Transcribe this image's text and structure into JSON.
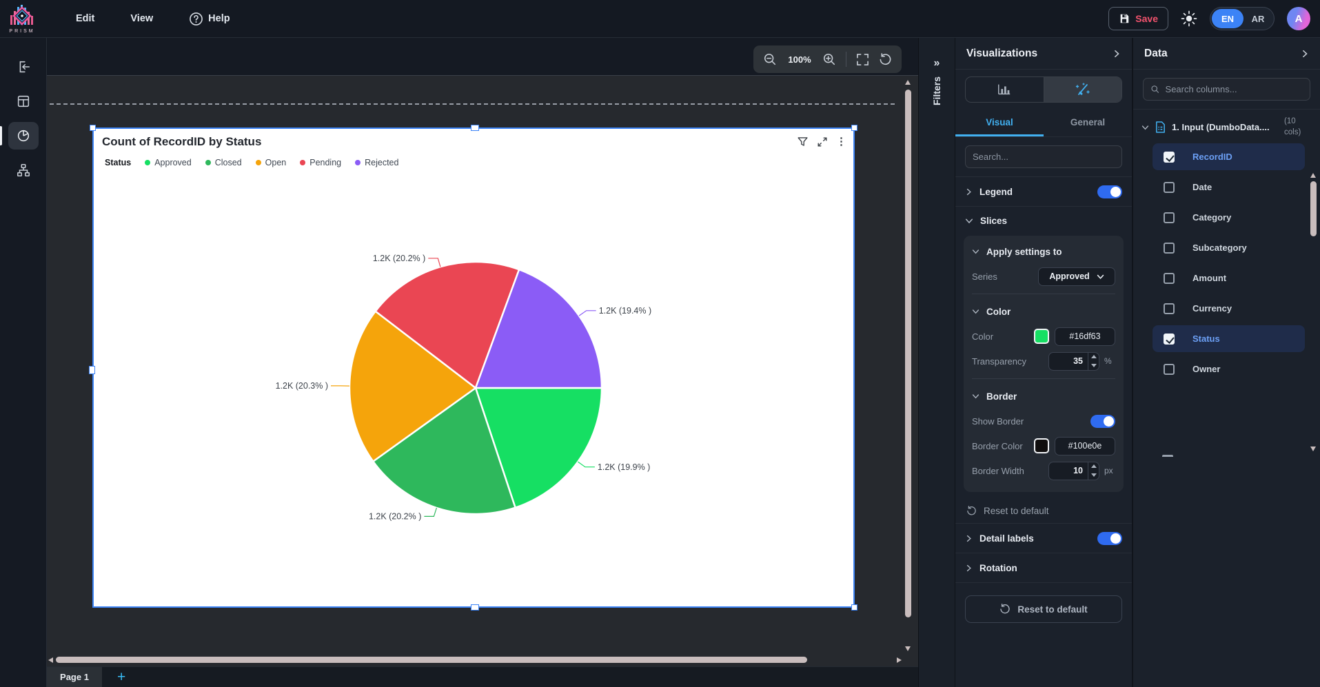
{
  "top_bar": {
    "logo_text": "PRISM",
    "menus": [
      "Edit",
      "View",
      "Help"
    ],
    "save_label": "Save",
    "lang": {
      "en": "EN",
      "ar": "AR"
    },
    "avatar_letter": "A"
  },
  "zoom_toolbar": {
    "zoom_level": "100%"
  },
  "filters_strip": {
    "label": "Filters"
  },
  "icons": {
    "collapse_double_chevron": "»",
    "kebab_menu": "⋮"
  },
  "chart_data": {
    "type": "pie",
    "title": "Count of RecordID by Status",
    "legend_title": "Status",
    "legend_position": "top",
    "start_angle_deg": 0,
    "direction": "clockwise",
    "value_display": "1.2K",
    "slices": [
      {
        "name": "Approved",
        "display_value": "1.2K",
        "pct": 19.9,
        "label": "1.2K (19.9% )",
        "color": "#16df63"
      },
      {
        "name": "Closed",
        "display_value": "1.2K",
        "pct": 20.2,
        "label": "1.2K (20.2% )",
        "color": "#2eb85c"
      },
      {
        "name": "Open",
        "display_value": "1.2K",
        "pct": 20.3,
        "label": "1.2K (20.3% )",
        "color": "#f5a40b"
      },
      {
        "name": "Pending",
        "display_value": "1.2K",
        "pct": 20.2,
        "label": "1.2K (20.2% )",
        "color": "#ea4653"
      },
      {
        "name": "Rejected",
        "display_value": "1.2K",
        "pct": 19.4,
        "label": "1.2K (19.4% )",
        "color": "#8b5cf6"
      }
    ]
  },
  "visualizations_panel": {
    "title": "Visualizations",
    "tabs": {
      "visual": "Visual",
      "general": "General"
    },
    "search_placeholder": "Search...",
    "legend_section": {
      "label": "Legend",
      "enabled": true
    },
    "slices_section": {
      "label": "Slices",
      "apply_settings": {
        "label": "Apply settings to",
        "series_label": "Series",
        "series_value": "Approved"
      },
      "color": {
        "label": "Color",
        "color_label": "Color",
        "color_value": "#16df63",
        "transparency_label": "Transparency",
        "transparency_value": "35",
        "transparency_unit": "%"
      },
      "border": {
        "label": "Border",
        "show_label": "Show Border",
        "show_enabled": true,
        "color_label": "Border Color",
        "color_value": "#100e0e",
        "width_label": "Border Width",
        "width_value": "10",
        "width_unit": "px"
      },
      "reset_label": "Reset to default"
    },
    "detail_labels_section": {
      "label": "Detail labels",
      "enabled": true
    },
    "rotation_section": {
      "label": "Rotation"
    },
    "reset_button_label": "Reset to default"
  },
  "data_panel": {
    "title": "Data",
    "search_placeholder": "Search columns...",
    "dataset": {
      "name": "1. Input (DumboData....",
      "cols_badge": "(10 cols)"
    },
    "columns": [
      {
        "name": "RecordID",
        "checked": true
      },
      {
        "name": "Date",
        "checked": false
      },
      {
        "name": "Category",
        "checked": false
      },
      {
        "name": "Subcategory",
        "checked": false
      },
      {
        "name": "Amount",
        "checked": false
      },
      {
        "name": "Currency",
        "checked": false
      },
      {
        "name": "Status",
        "checked": true
      },
      {
        "name": "Owner",
        "checked": false
      }
    ]
  },
  "pages_bar": {
    "page_label": "Page 1",
    "add_label": "+"
  }
}
